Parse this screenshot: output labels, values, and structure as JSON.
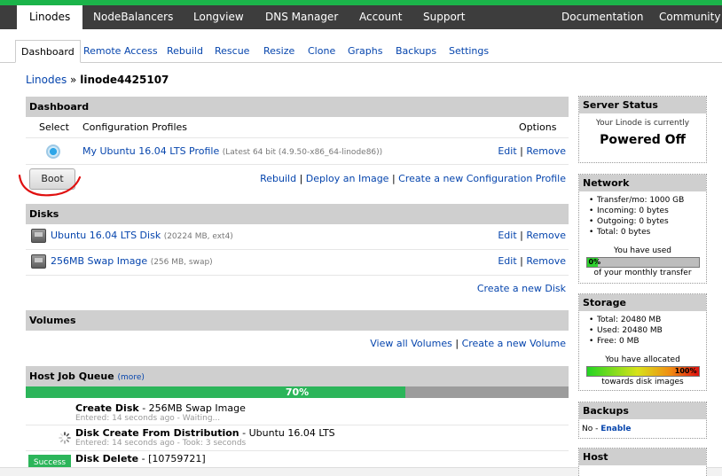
{
  "topnav": {
    "items": [
      "Linodes",
      "NodeBalancers",
      "Longview",
      "DNS Manager",
      "Account",
      "Support"
    ],
    "right_items": [
      "Documentation",
      "Community"
    ]
  },
  "subnav": {
    "tabs": [
      "Dashboard",
      "Remote Access",
      "Rebuild",
      "Rescue",
      "Resize",
      "Clone",
      "Graphs",
      "Backups",
      "Settings"
    ]
  },
  "breadcrumb": {
    "root": "Linodes",
    "sep": "»",
    "current": "linode4425107"
  },
  "dashboard": {
    "title": "Dashboard",
    "col_select": "Select",
    "col_profiles": "Configuration Profiles",
    "col_options": "Options",
    "profile": {
      "name": "My Ubuntu 16.04 LTS Profile",
      "detail": "(Latest 64 bit (4.9.50-x86_64-linode86))"
    },
    "edit": "Edit",
    "remove": "Remove",
    "pipe": "|",
    "boot": "Boot",
    "rebuild": "Rebuild",
    "deploy": "Deploy an Image",
    "new_profile": "Create a new Configuration Profile"
  },
  "disks": {
    "title": "Disks",
    "items": [
      {
        "name": "Ubuntu 16.04 LTS Disk",
        "detail": "(20224 MB, ext4)"
      },
      {
        "name": "256MB Swap Image",
        "detail": "(256 MB, swap)"
      }
    ],
    "create": "Create a new Disk"
  },
  "volumes": {
    "title": "Volumes",
    "view_all": "View all Volumes",
    "create": "Create a new Volume"
  },
  "jobs": {
    "title": "Host Job Queue",
    "more": "(more)",
    "progress_label": "70%",
    "progress": 0.7,
    "items": [
      {
        "title": "Create Disk",
        "desc": " - 256MB Swap Image",
        "sub": "Entered: 14 seconds ago - Waiting..."
      },
      {
        "title": "Disk Create From Distribution",
        "desc": " - Ubuntu 16.04 LTS",
        "sub": "Entered: 14 seconds ago - Took: 3 seconds"
      },
      {
        "title": "Disk Delete",
        "desc": " - [10759721]",
        "sub": ""
      }
    ],
    "success_badge": "Success"
  },
  "sidebar": {
    "status": {
      "title": "Server Status",
      "line": "Your Linode is currently",
      "state": "Powered Off"
    },
    "network": {
      "title": "Network",
      "items": [
        "Transfer/mo: 1000 GB",
        "Incoming: 0 bytes",
        "Outgoing: 0 bytes",
        "Total: 0 bytes"
      ],
      "used_label": "You have used",
      "pct_label": "0%",
      "pct": 0.0,
      "footer": "of your monthly transfer"
    },
    "storage": {
      "title": "Storage",
      "items": [
        "Total: 20480 MB",
        "Used: 20480 MB",
        "Free: 0 MB"
      ],
      "alloc_label": "You have allocated",
      "pct_label": "100%",
      "pct": 1.0,
      "footer": "towards disk images"
    },
    "backups": {
      "title": "Backups",
      "text": "No - ",
      "enable": "Enable"
    },
    "host": {
      "title": "Host"
    }
  },
  "colors": {
    "accent_green": "#1bb44a",
    "topbar_bg": "#3d3d3d",
    "link": "#0645ad",
    "header_gray": "#cfcfcf"
  }
}
